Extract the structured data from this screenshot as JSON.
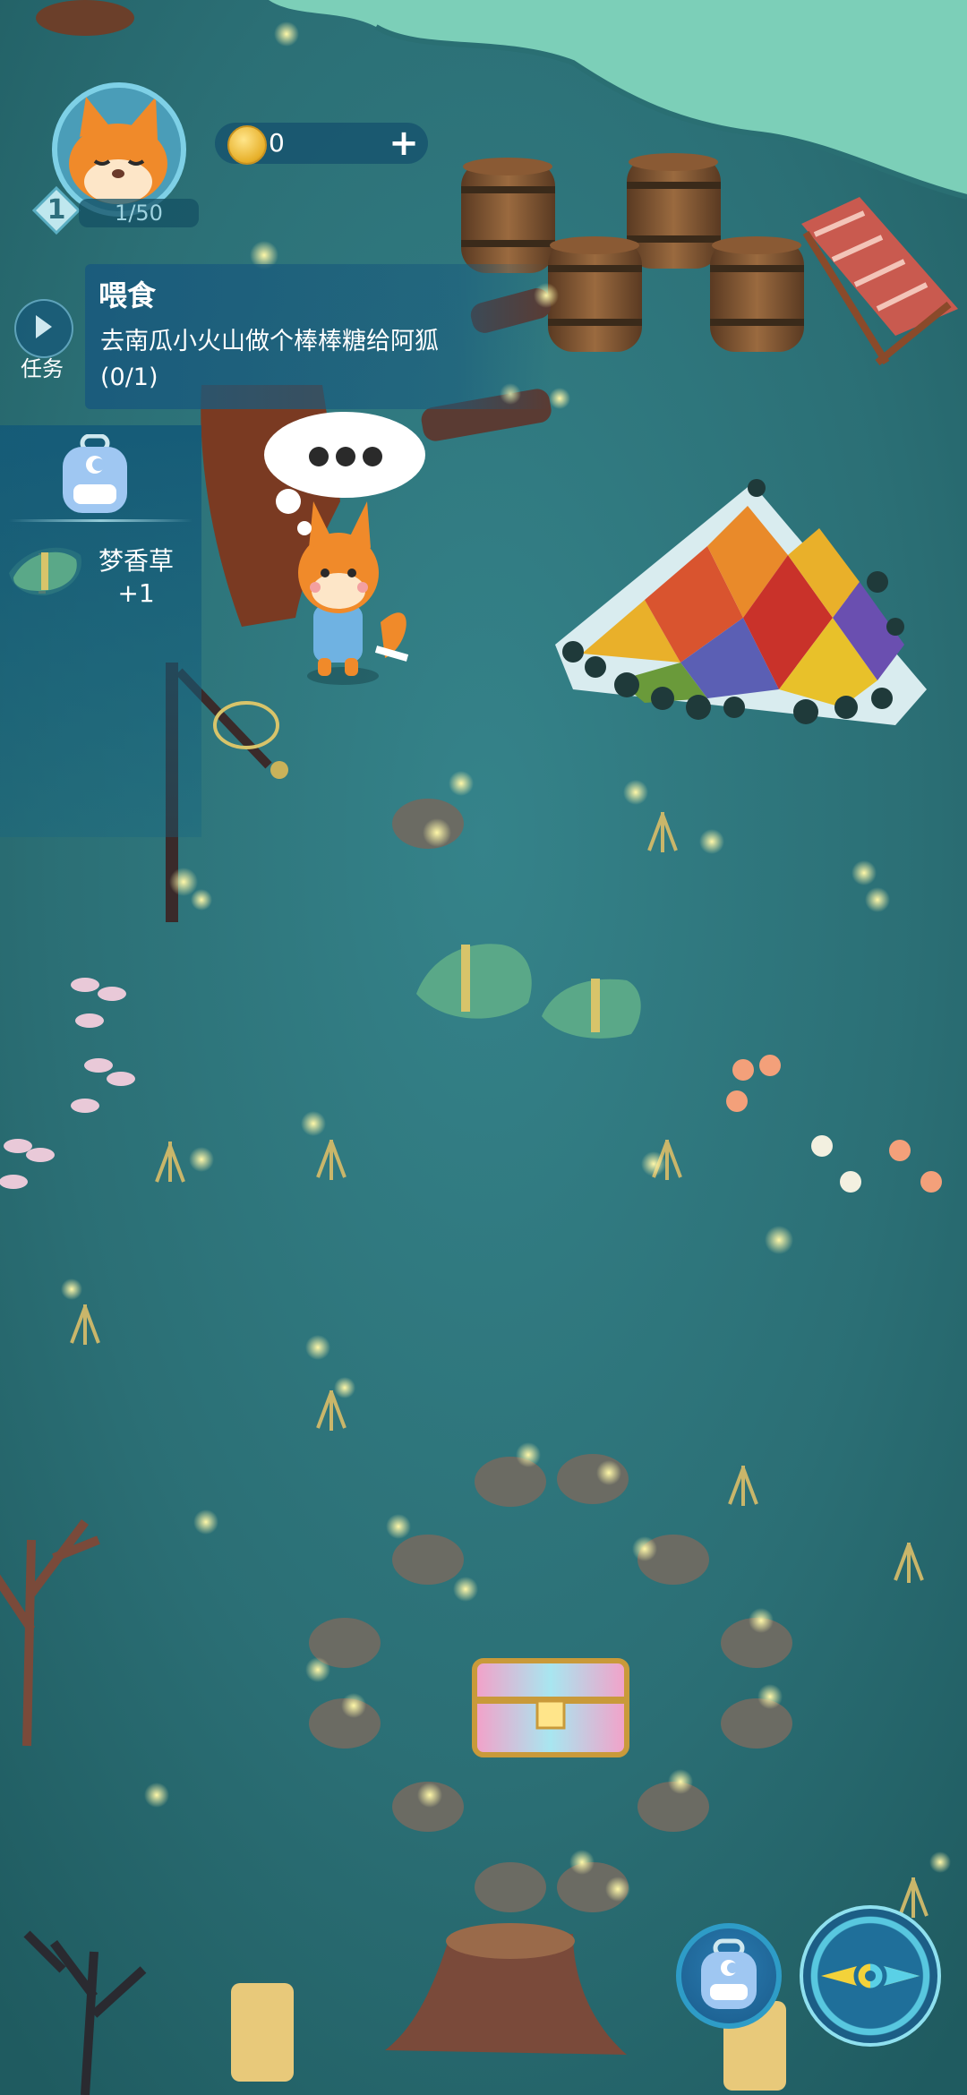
{
  "player": {
    "level": "1",
    "xp": "1/50",
    "coins": "0",
    "add_symbol": "+"
  },
  "quest": {
    "toggle_label": "任务",
    "title": "喂食",
    "description": "去南瓜小火山做个棒棒糖给阿狐",
    "progress": "(0/1)"
  },
  "pickup": {
    "item_name": "梦香草",
    "amount": "+1"
  },
  "icons": {
    "avatar": "fox-avatar-icon",
    "coin": "coin-icon",
    "add": "plus-icon",
    "quest_toggle": "play-arrow-icon",
    "bag": "backpack-icon",
    "compass": "compass-icon",
    "thought": "thought-bubble-icon"
  },
  "colors": {
    "ground": "#2f7a7c",
    "water": "#7ccfb8",
    "ui_panel": "#19597d",
    "accent": "#7ed0e6"
  }
}
